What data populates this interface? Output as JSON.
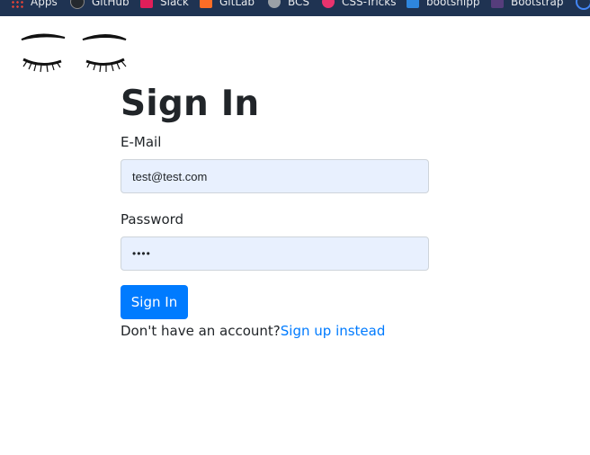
{
  "bookmarks": [
    {
      "label": "Apps",
      "icon": "apps-grid-icon",
      "color": "#ea4335"
    },
    {
      "label": "GitHub",
      "icon": "github-icon",
      "color": "#24292e"
    },
    {
      "label": "Slack",
      "icon": "slack-icon",
      "color": "#4a154b"
    },
    {
      "label": "GitLab",
      "icon": "gitlab-icon",
      "color": "#fc6d26"
    },
    {
      "label": "BCS",
      "icon": "bcs-icon",
      "color": "#9aa0a6"
    },
    {
      "label": "CSS-Tricks",
      "icon": "css-tricks-icon",
      "color": "#e8336e"
    },
    {
      "label": "bootsnipp",
      "icon": "bootsnipp-icon",
      "color": "#2e86de"
    },
    {
      "label": "Bootstrap",
      "icon": "bootstrap-icon",
      "color": "#563d7c"
    }
  ],
  "logo": {
    "icon": "eyelashes-logo-icon"
  },
  "signin": {
    "title": "Sign In",
    "email_label": "E-Mail",
    "email_value": "test@test.com",
    "password_label": "Password",
    "password_value": "••••",
    "submit_label": "Sign In",
    "prompt_text": "Don't have an account?",
    "signup_link": "Sign up instead"
  },
  "colors": {
    "primary": "#007bff",
    "input_bg": "#e8f0fe",
    "bar_bg": "#1f3352"
  }
}
